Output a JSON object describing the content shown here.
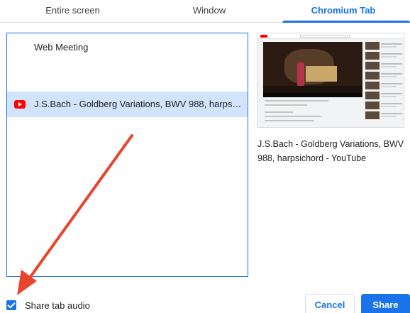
{
  "tabs": [
    {
      "label": "Entire screen"
    },
    {
      "label": "Window"
    },
    {
      "label": "Chromium Tab"
    }
  ],
  "active_tab": "Chromium Tab",
  "sources": [
    {
      "label": "Web Meeting",
      "icon": null
    },
    {
      "label": "J.S.Bach - Goldberg Variations, BWV 988, harpsichord - YouTube",
      "icon": "youtube-icon",
      "selected": true
    }
  ],
  "preview": {
    "caption": "J.S.Bach - Goldberg Variations, BWV 988, harpsichord - YouTube"
  },
  "share_audio": {
    "label": "Share tab audio",
    "checked": true
  },
  "buttons": {
    "cancel": "Cancel",
    "share": "Share"
  },
  "colors": {
    "accent": "#1a73e8",
    "selected_row": "#d2e3fc",
    "annotation_arrow": "#e8452c"
  }
}
